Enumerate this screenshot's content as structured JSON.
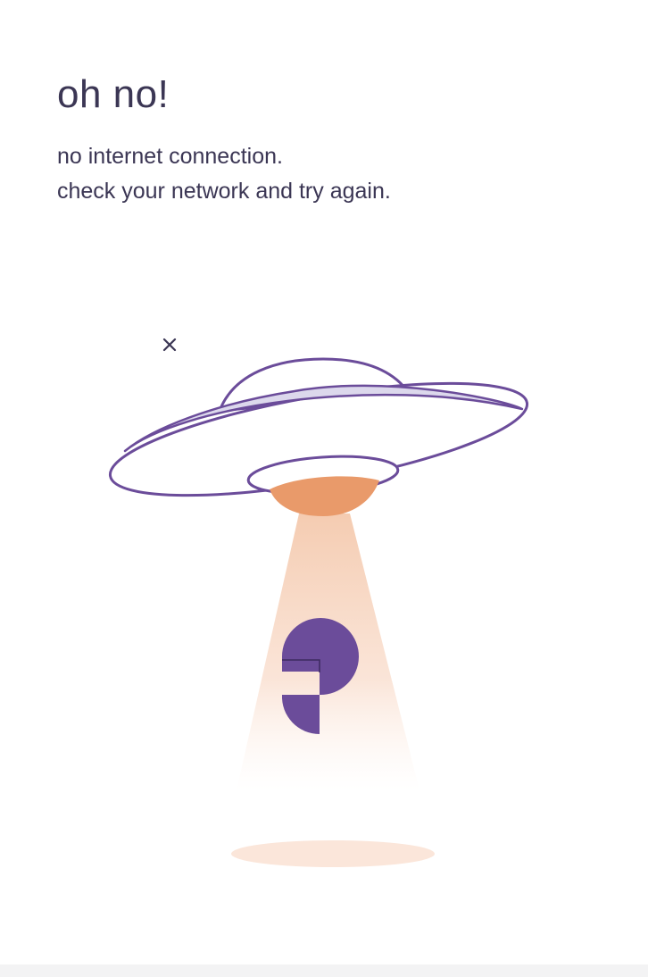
{
  "error": {
    "headline": "oh no!",
    "message_line_1": "no internet connection.",
    "message_line_2": "check your network and try again."
  },
  "illustration": {
    "icons": [
      "sparkle-icon",
      "ufo-icon",
      "light-beam-icon",
      "question-mark-icon",
      "ground-shadow-icon"
    ],
    "colors": {
      "outline": "#6b4c9a",
      "dome_fill": "#ffffff",
      "rim_fill": "#dcd8ec",
      "light": "#e99a6a",
      "beam": "#f6d5c0",
      "shadow": "#fbe6da",
      "question_mark": "#6b4c9a"
    }
  },
  "theme": {
    "text": "#3b3654",
    "background": "#ffffff"
  }
}
